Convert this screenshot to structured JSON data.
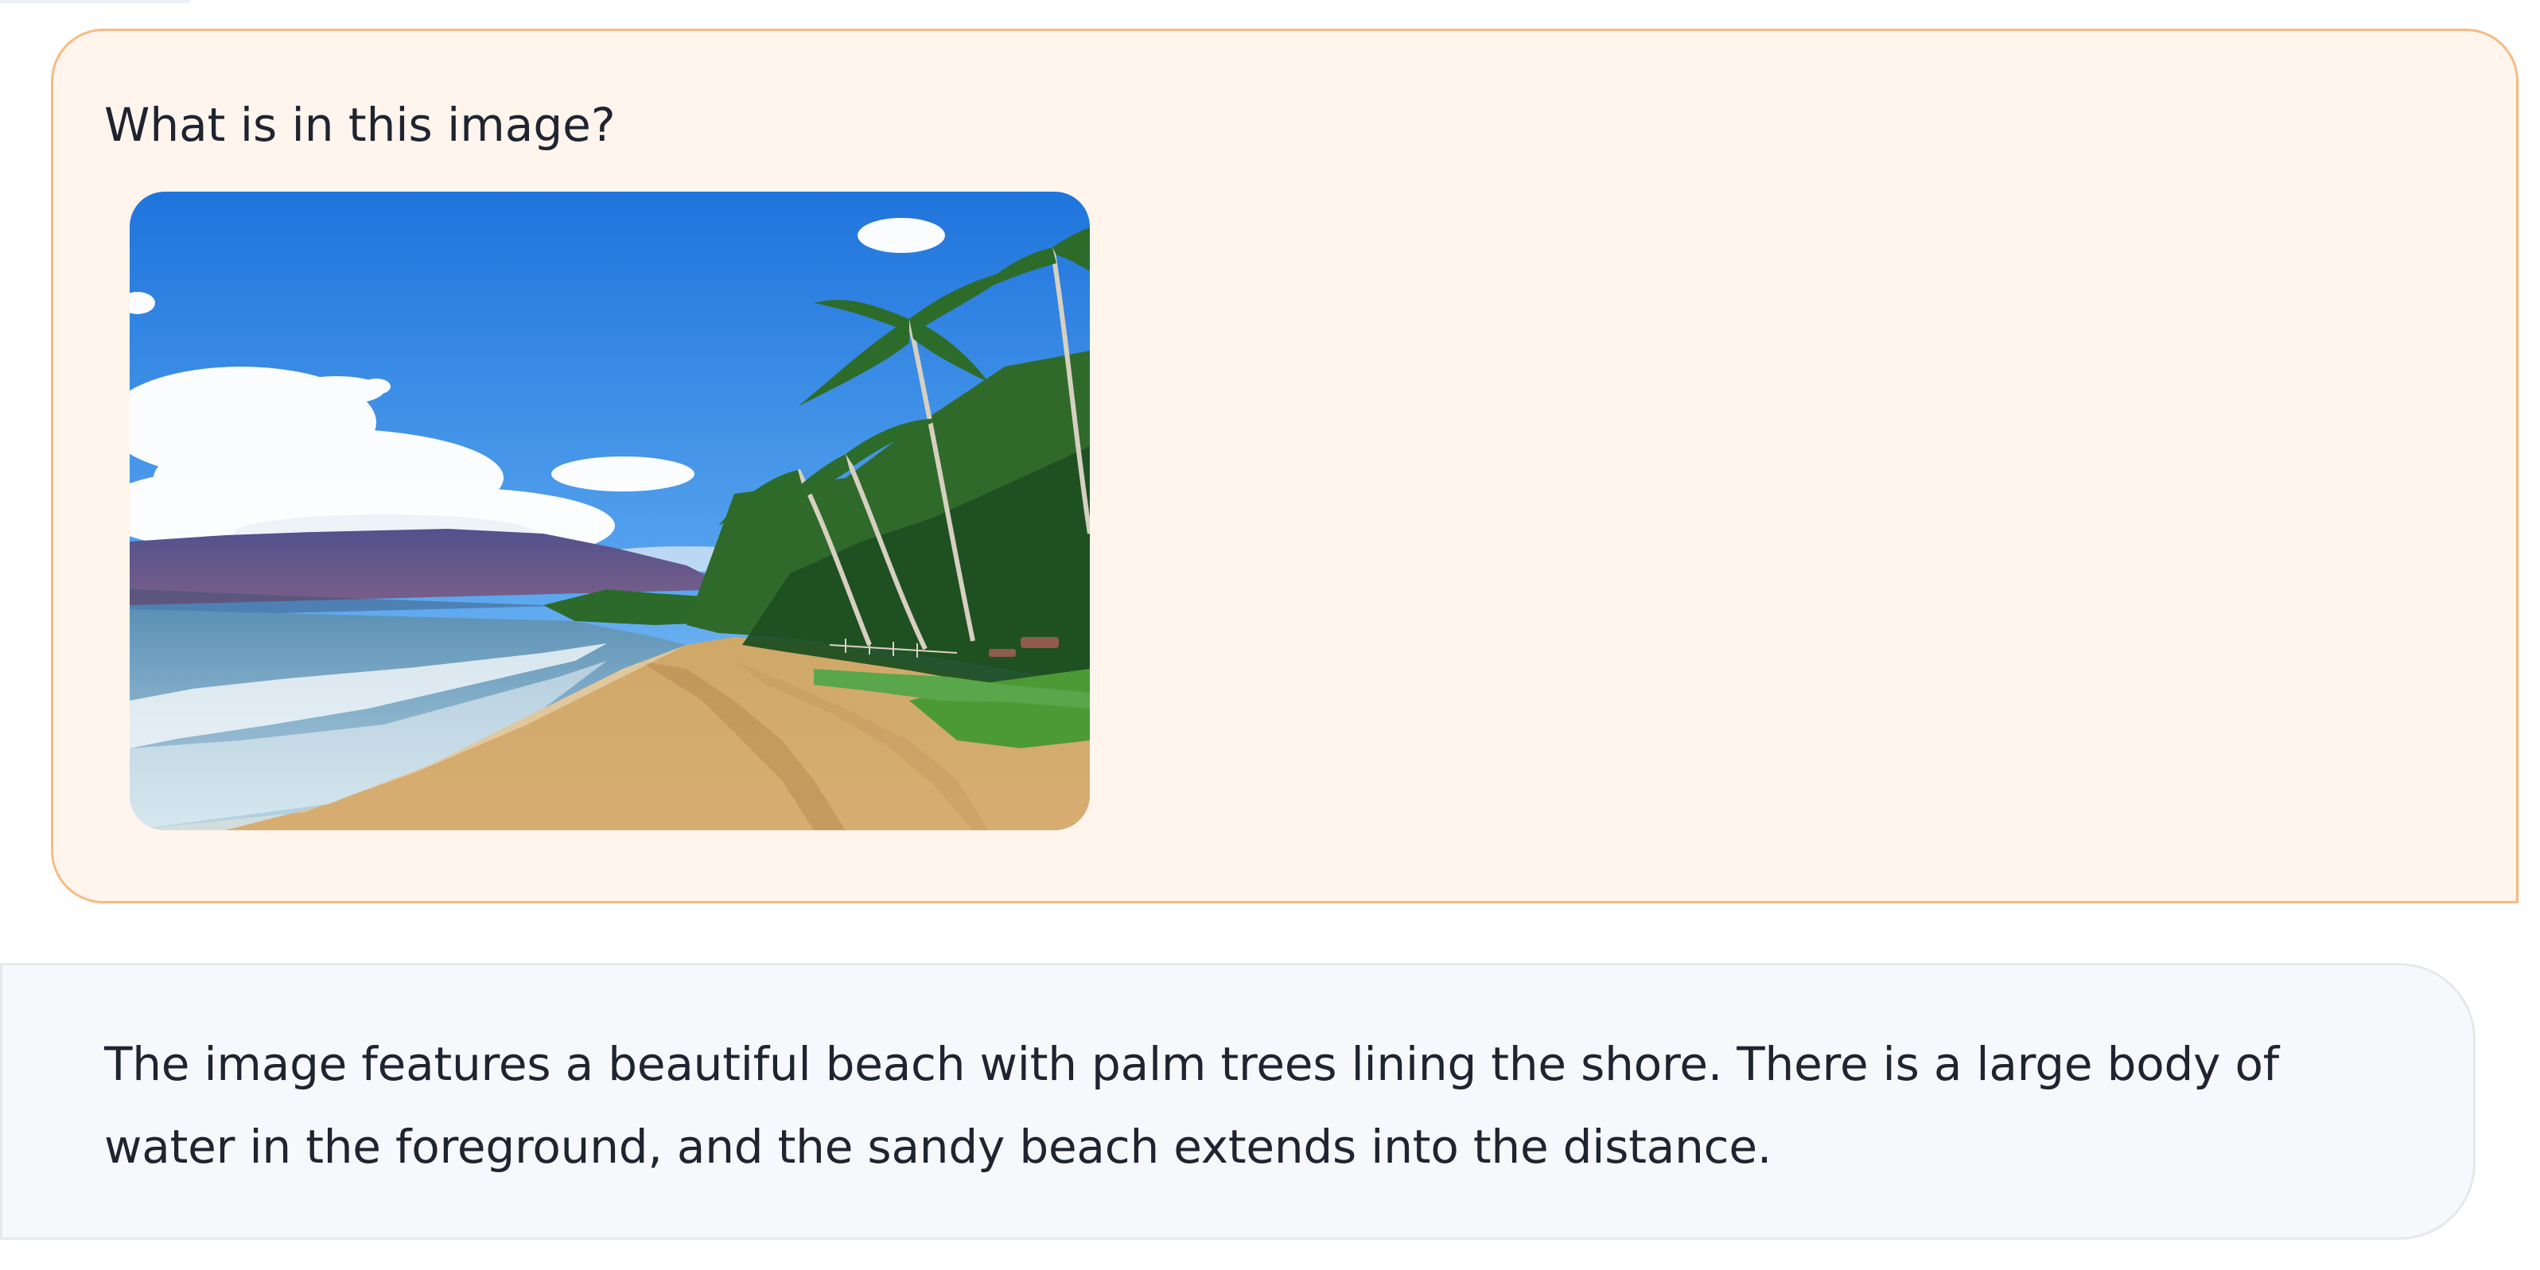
{
  "chat": {
    "user_message": {
      "text": "What is in this image?",
      "attachment": {
        "type": "image",
        "subject": "tropical beach with palm trees, ocean, mountains and blue sky"
      }
    },
    "assistant_message": {
      "text": "The image features a beautiful beach with palm trees lining the shore. There is a large body of water in the foreground, and the sandy beach extends into the distance."
    }
  },
  "colors": {
    "user_bubble_bg": "#fff5ed",
    "user_bubble_border": "#f7bb82",
    "assistant_bubble_bg": "#f6f8fb",
    "assistant_bubble_border": "#e5e8ed",
    "text": "#1f2430"
  }
}
